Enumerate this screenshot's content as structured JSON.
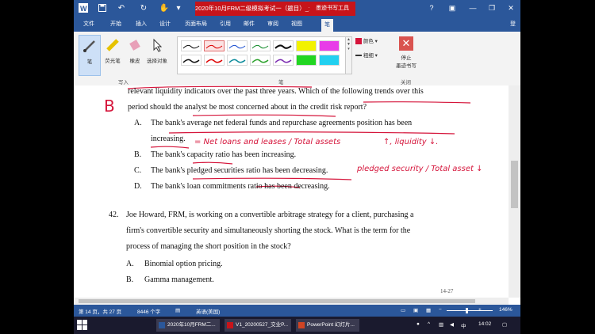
{
  "titlebar": {
    "document_title": "2020年10月FRM二级模拟考试一（题目）_全...",
    "context_tab": "墨迹书写工具",
    "signin": "登录",
    "min": "—",
    "restore": "❐",
    "close": "✕",
    "help": "?"
  },
  "tabs": [
    "文件",
    "开始",
    "插入",
    "设计",
    "页面布局",
    "引用",
    "邮件",
    "审阅",
    "视图",
    "笔"
  ],
  "ribbon": {
    "pen_label": "笔",
    "highlighter_label": "荧光笔",
    "eraser_label": "橡皮",
    "select_label": "选择对象",
    "group_write": "写入",
    "group_pens": "笔",
    "group_close": "关闭",
    "color_label": "颜色 ▾",
    "thickness_label": "粗细 ▾",
    "stop_label_1": "停止",
    "stop_label_2": "墨迹书写"
  },
  "document": {
    "line1": "relevant liquidity indicators over the past three years. Which of the following trends over this",
    "line2": "period should the analyst be most concerned about in the credit risk report?",
    "optA_letter": "A.",
    "optA_text1": "The bank's average net federal funds and repurchase agreements position has been",
    "optA_text2": "increasing.",
    "optB_letter": "B.",
    "optB_text": "The bank's capacity ratio has been increasing.",
    "optC_letter": "C.",
    "optC_text": "The bank's pledged securities ratio has been decreasing.",
    "optD_letter": "D.",
    "optD_text": "The bank's loan commitments ratio has been decreasing.",
    "q42_num": "42.",
    "q42_line1": "Joe Howard, FRM, is working on a convertible arbitrage strategy for a client, purchasing a",
    "q42_line2": "firm's convertible security and simultaneously shorting the stock. What is the term for the",
    "q42_line3": "process of managing the short position in the stock?",
    "q42_optA_letter": "A.",
    "q42_optA_text": "Binomial option pricing.",
    "q42_optB_letter": "B.",
    "q42_optB_text": "Gamma management.",
    "page_marker": "14-27"
  },
  "ink": {
    "answer": "B",
    "note_a": "= Net loans and leases / Total assets",
    "note_a_arrow": "↑, liquidity ↓.",
    "note_c": "pledged security / Total asset ↓"
  },
  "status": {
    "page": "第 14 页，共 27 页",
    "words": "8446 个字",
    "lang": "英语(美国)",
    "zoom": "146%",
    "zoom_minus": "−",
    "zoom_plus": "+"
  },
  "taskbar": {
    "items": [
      "2020年10月FRM二...",
      "V1_20200527_交业P...",
      "PowerPoint 幻灯片..."
    ],
    "time": "14:02"
  },
  "colors": {
    "word_blue": "#2b579a",
    "title_red": "#c7141a",
    "ink_red": "#d5143a"
  }
}
